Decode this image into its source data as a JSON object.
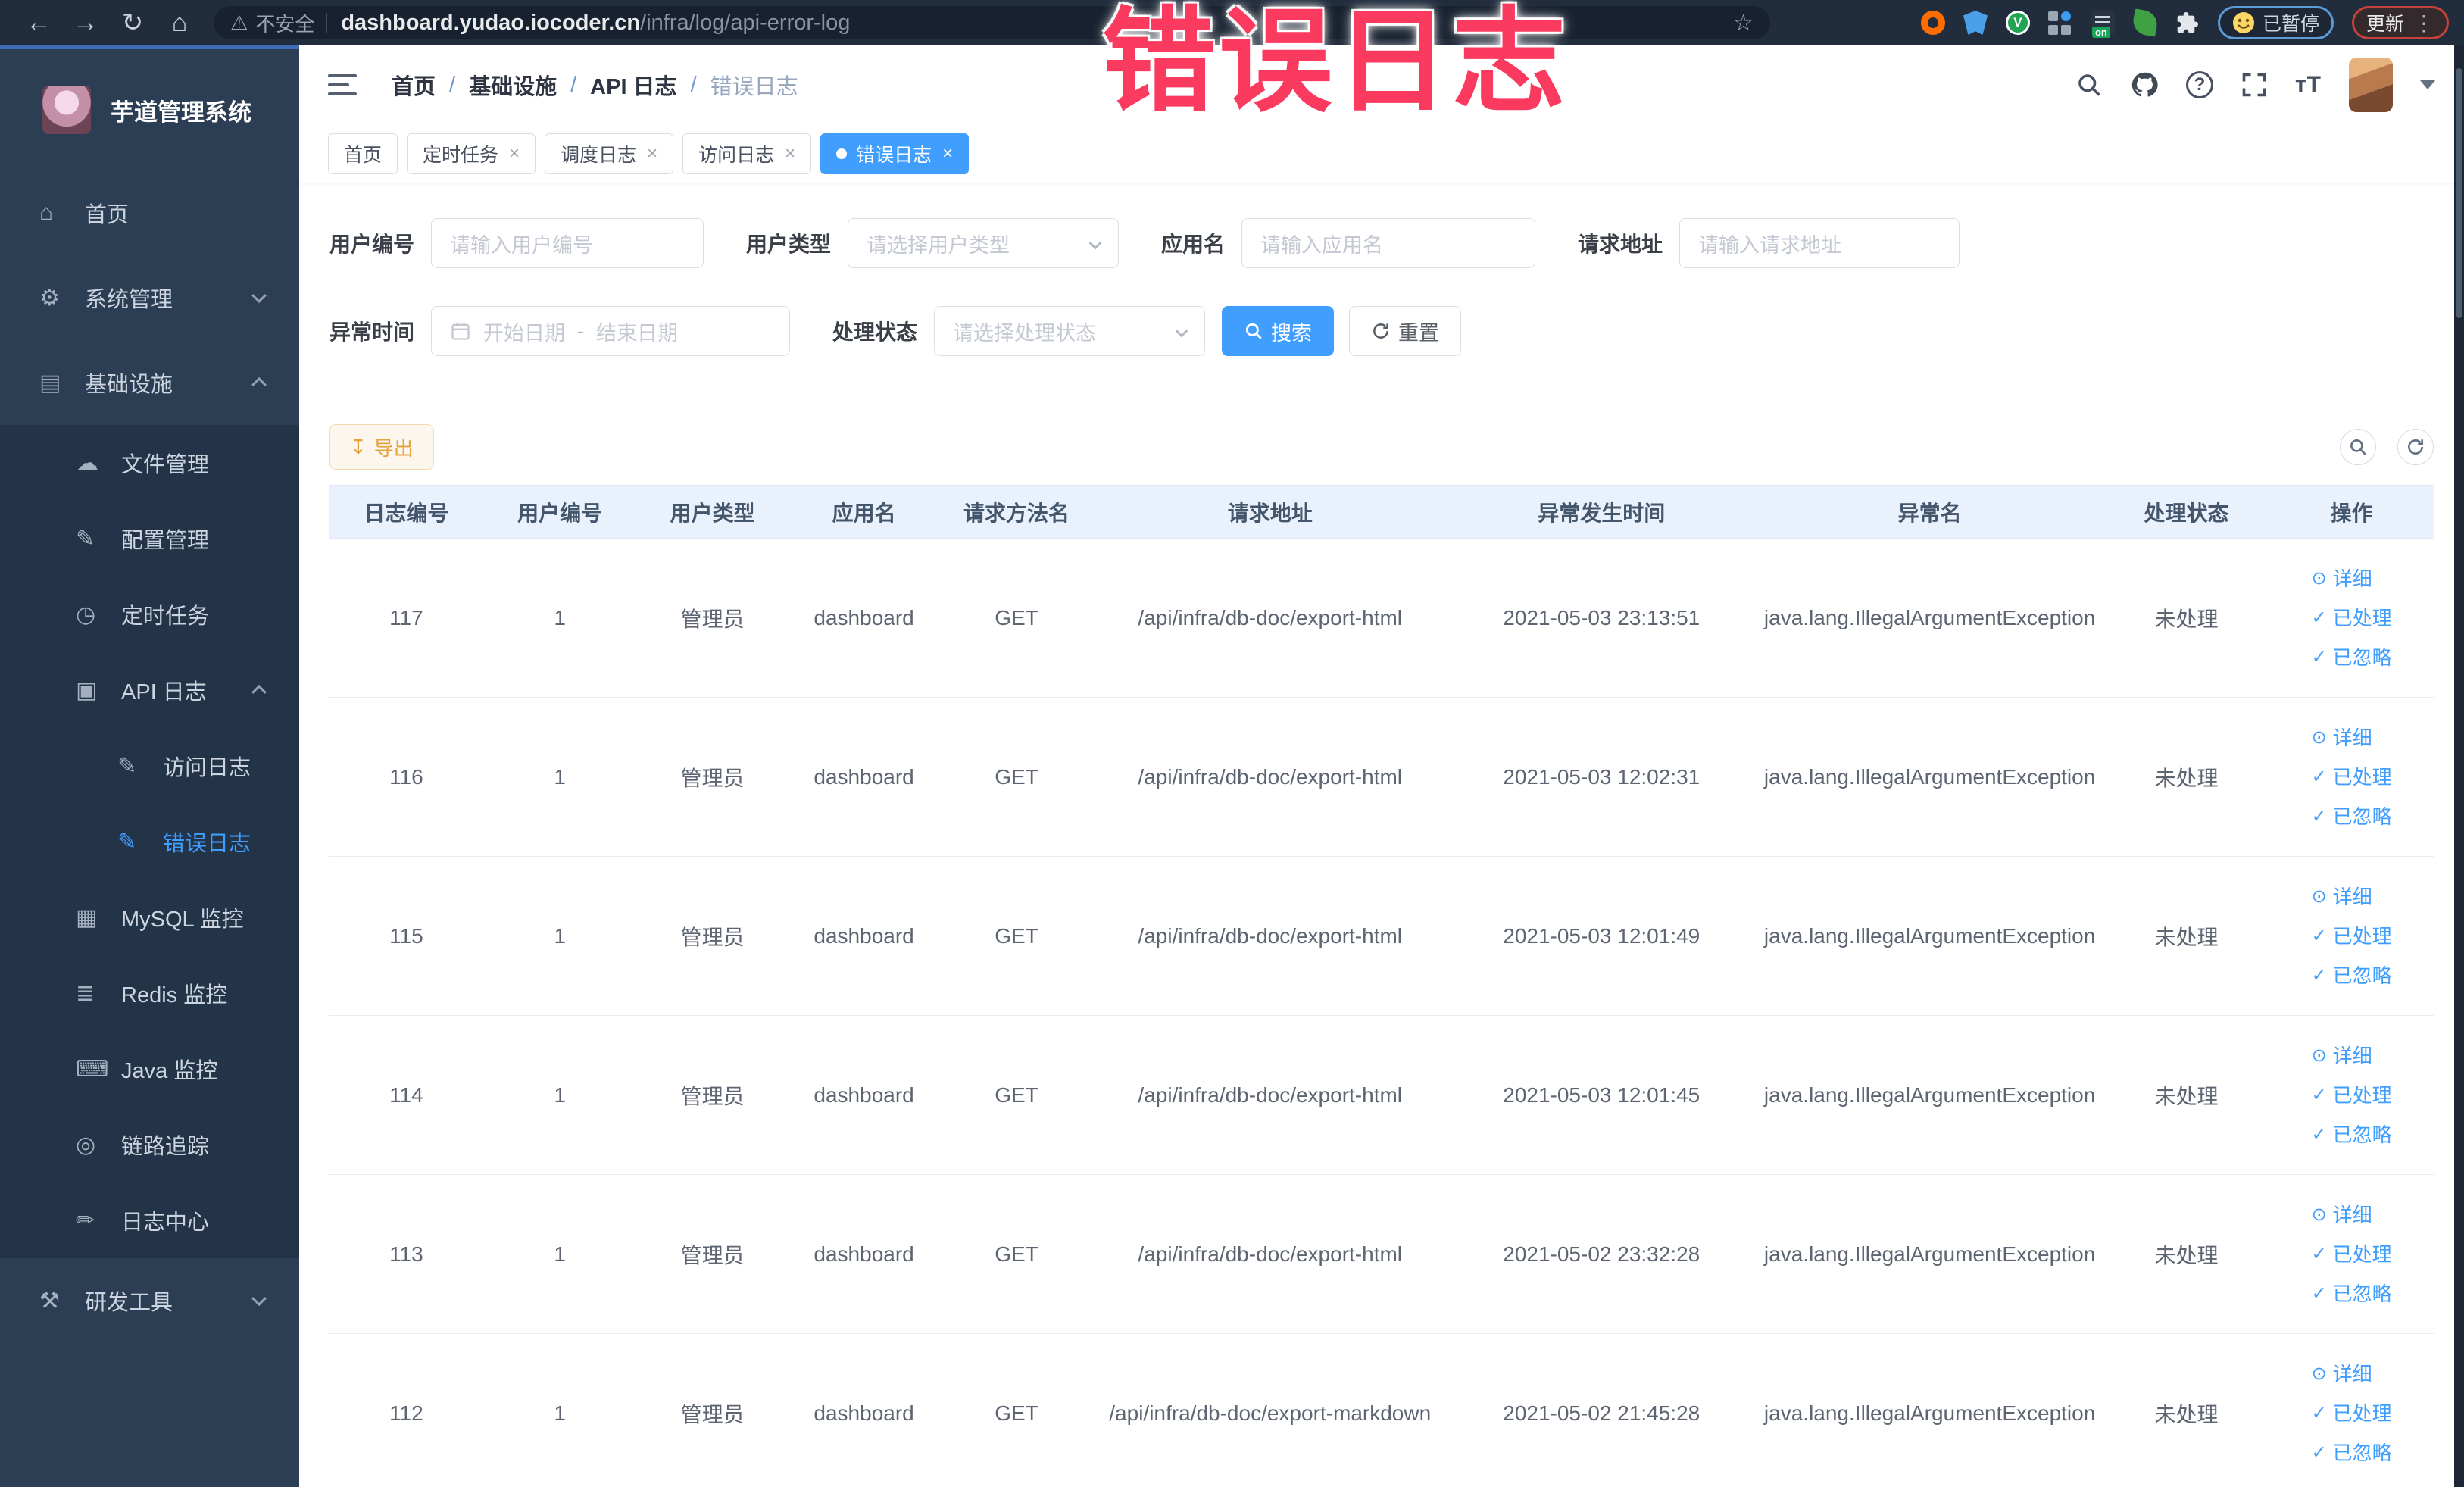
{
  "browser": {
    "back_icon": "←",
    "forward_icon": "→",
    "reload_icon": "↻",
    "home_icon": "⌂",
    "warning_icon": "⚠",
    "security_label": "不安全",
    "url_domain": "dashboard.yudao.iocoder.cn",
    "url_path": "/infra/log/api-error-log",
    "bookmark_star": "☆",
    "ontab_badge": "on",
    "paused_chip_label": "已暂停",
    "update_chip_label": "更新",
    "kebab_icon": "⋮"
  },
  "watermark": {
    "text": "错误日志",
    "color": "#fa3a5f"
  },
  "sidebar": {
    "title": "芋道管理系统",
    "items": [
      {
        "label": "首页",
        "icon": "home-icon",
        "glyph": "⌂",
        "level": 1,
        "dark": false
      },
      {
        "label": "系统管理",
        "icon": "gear-icon",
        "glyph": "⚙",
        "level": 1,
        "dark": false,
        "arrow": "down"
      },
      {
        "label": "基础设施",
        "icon": "infrastructure-icon",
        "glyph": "▤",
        "level": 1,
        "dark": false,
        "arrow": "up"
      },
      {
        "label": "文件管理",
        "icon": "file-upload-icon",
        "glyph": "☁",
        "level": 2,
        "dark": true
      },
      {
        "label": "配置管理",
        "icon": "config-edit-icon",
        "glyph": "✎",
        "level": 2,
        "dark": true
      },
      {
        "label": "定时任务",
        "icon": "timer-icon",
        "glyph": "◷",
        "level": 2,
        "dark": true
      },
      {
        "label": "API 日志",
        "icon": "api-log-icon",
        "glyph": "▣",
        "level": 2,
        "dark": true,
        "arrow": "up"
      },
      {
        "label": "访问日志",
        "icon": "access-log-icon",
        "glyph": "✎",
        "level": 3,
        "dark": true
      },
      {
        "label": "错误日志",
        "icon": "error-log-icon",
        "glyph": "✎",
        "level": 3,
        "dark": true,
        "active": true
      },
      {
        "label": "MySQL 监控",
        "icon": "mysql-monitor-icon",
        "glyph": "▦",
        "level": 2,
        "dark": true
      },
      {
        "label": "Redis 监控",
        "icon": "redis-monitor-icon",
        "glyph": "≣",
        "level": 2,
        "dark": true
      },
      {
        "label": "Java 监控",
        "icon": "java-monitor-icon",
        "glyph": "⌨",
        "level": 2,
        "dark": true
      },
      {
        "label": "链路追踪",
        "icon": "trace-icon",
        "glyph": "◎",
        "level": 2,
        "dark": true
      },
      {
        "label": "日志中心",
        "icon": "log-center-icon",
        "glyph": "✏",
        "level": 2,
        "dark": true
      },
      {
        "label": "研发工具",
        "icon": "dev-tools-icon",
        "glyph": "⚒",
        "level": 1,
        "dark": false,
        "arrow": "down"
      }
    ]
  },
  "breadcrumb": {
    "items": [
      "首页",
      "基础设施",
      "API 日志",
      "错误日志"
    ],
    "separator": "/"
  },
  "tabs": [
    {
      "label": "首页",
      "closable": false,
      "active": false
    },
    {
      "label": "定时任务",
      "closable": true,
      "active": false
    },
    {
      "label": "调度日志",
      "closable": true,
      "active": false
    },
    {
      "label": "访问日志",
      "closable": true,
      "active": false
    },
    {
      "label": "错误日志",
      "closable": true,
      "active": true
    }
  ],
  "filters": {
    "user_id_label": "用户编号",
    "user_id_placeholder": "请输入用户编号",
    "user_type_label": "用户类型",
    "user_type_placeholder": "请选择用户类型",
    "app_name_label": "应用名",
    "app_name_placeholder": "请输入应用名",
    "request_url_label": "请求地址",
    "request_url_placeholder": "请输入请求地址",
    "exception_time_label": "异常时间",
    "start_placeholder": "开始日期",
    "range_separator": "-",
    "end_placeholder": "结束日期",
    "process_status_label": "处理状态",
    "process_status_placeholder": "请选择处理状态",
    "search_button": "搜索",
    "reset_button": "重置"
  },
  "toolbar": {
    "export_button": "导出",
    "export_icon": "↧"
  },
  "table": {
    "columns": [
      "日志编号",
      "用户编号",
      "用户类型",
      "应用名",
      "请求方法名",
      "请求地址",
      "异常发生时间",
      "异常名",
      "处理状态",
      "操作"
    ],
    "col_widths": [
      "7.3%",
      "7.3%",
      "7.2%",
      "7.2%",
      "7.3%",
      "16.8%",
      "14.7%",
      "16.5%",
      "7.9%",
      "7.8%"
    ],
    "action_labels": [
      "详细",
      "已处理",
      "已忽略"
    ],
    "action_icons": [
      "⊙",
      "✓",
      "✓"
    ],
    "rows": [
      {
        "id": "117",
        "user_id": "1",
        "user_type": "管理员",
        "app": "dashboard",
        "method": "GET",
        "url": "/api/infra/db-doc/export-html",
        "time": "2021-05-03 23:13:51",
        "exception": "java.lang.IllegalArgumentException",
        "status": "未处理"
      },
      {
        "id": "116",
        "user_id": "1",
        "user_type": "管理员",
        "app": "dashboard",
        "method": "GET",
        "url": "/api/infra/db-doc/export-html",
        "time": "2021-05-03 12:02:31",
        "exception": "java.lang.IllegalArgumentException",
        "status": "未处理"
      },
      {
        "id": "115",
        "user_id": "1",
        "user_type": "管理员",
        "app": "dashboard",
        "method": "GET",
        "url": "/api/infra/db-doc/export-html",
        "time": "2021-05-03 12:01:49",
        "exception": "java.lang.IllegalArgumentException",
        "status": "未处理"
      },
      {
        "id": "114",
        "user_id": "1",
        "user_type": "管理员",
        "app": "dashboard",
        "method": "GET",
        "url": "/api/infra/db-doc/export-html",
        "time": "2021-05-03 12:01:45",
        "exception": "java.lang.IllegalArgumentException",
        "status": "未处理"
      },
      {
        "id": "113",
        "user_id": "1",
        "user_type": "管理员",
        "app": "dashboard",
        "method": "GET",
        "url": "/api/infra/db-doc/export-html",
        "time": "2021-05-02 23:32:28",
        "exception": "java.lang.IllegalArgumentException",
        "status": "未处理"
      },
      {
        "id": "112",
        "user_id": "1",
        "user_type": "管理员",
        "app": "dashboard",
        "method": "GET",
        "url": "/api/infra/db-doc/export-markdown",
        "time": "2021-05-02 21:45:28",
        "exception": "java.lang.IllegalArgumentException",
        "status": "未处理"
      }
    ]
  },
  "colors": {
    "accent": "#409eff",
    "active_tab_bg": "#409eff",
    "export_text": "#e6a23c",
    "watermark": "#fa3a5f",
    "sidebar_bg": "#2c3e54",
    "sidebar_sub_bg": "#233448",
    "table_header_bg": "#e9f1fc"
  }
}
